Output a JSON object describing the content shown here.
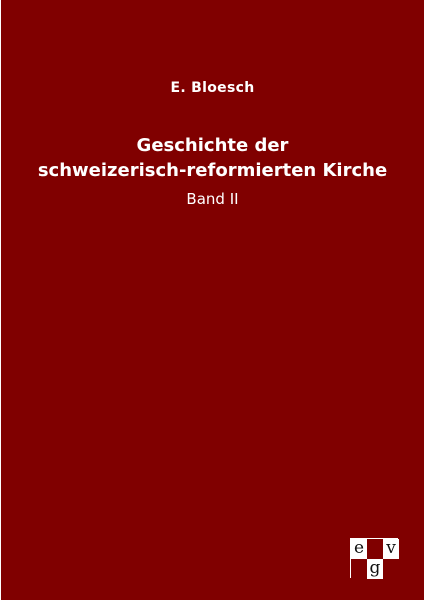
{
  "cover": {
    "author": "E. Bloesch",
    "title_line_1": "Geschichte der",
    "title_line_2": "schweizerisch-reformierten Kirche",
    "volume": "Band II",
    "background_color": "#800000",
    "text_color": "#ffffff"
  },
  "logo": {
    "top_left": "e",
    "bottom_middle": "g",
    "top_right": "v"
  }
}
